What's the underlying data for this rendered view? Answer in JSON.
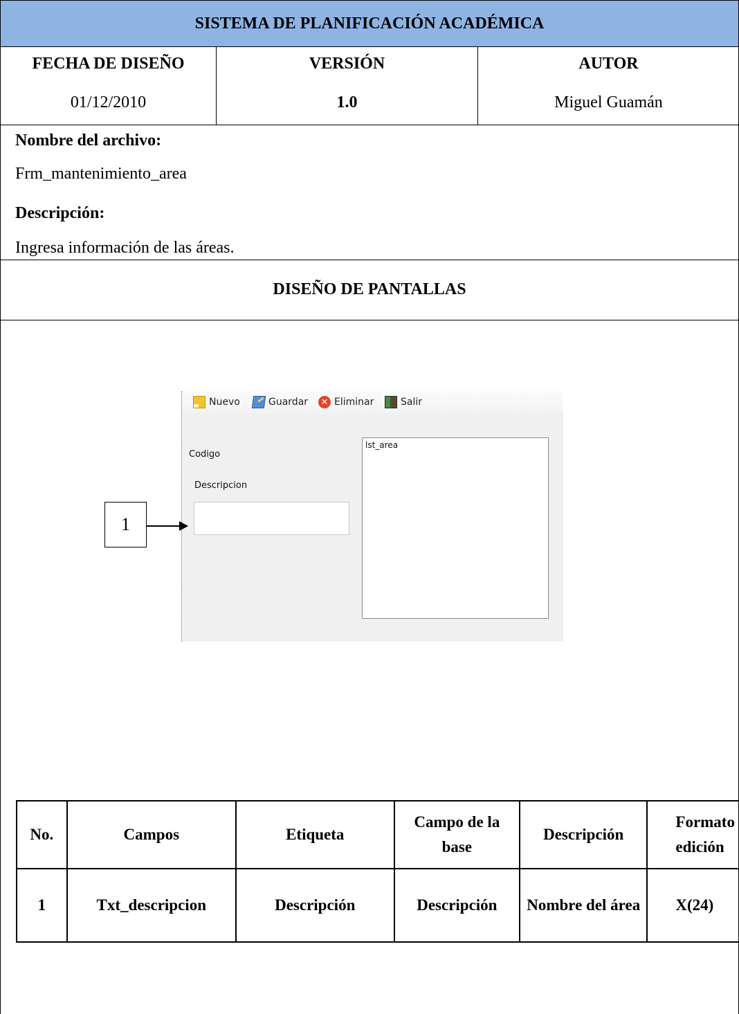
{
  "header": {
    "title": "SISTEMA DE PLANIFICACIÓN ACADÉMICA"
  },
  "meta": {
    "fecha_label": "FECHA DE DISEÑO",
    "fecha_value": "01/12/2010",
    "version_label": "VERSIÓN",
    "version_value": "1.0",
    "autor_label": "AUTOR",
    "autor_value": "Miguel Guamán"
  },
  "info": {
    "archivo_label": "Nombre del archivo:",
    "archivo_value": "Frm_mantenimiento_area",
    "descripcion_label": "Descripción:",
    "descripcion_value": "Ingresa información de las áreas."
  },
  "section": {
    "title": "DISEÑO DE PANTALLAS"
  },
  "screenshot": {
    "toolbar": [
      {
        "label": "Nuevo",
        "icon": "new-icon"
      },
      {
        "label": "Guardar",
        "icon": "save-icon"
      },
      {
        "label": "Eliminar",
        "icon": "delete-icon"
      },
      {
        "label": "Salir",
        "icon": "exit-icon"
      }
    ],
    "codigo_label": "Codigo",
    "descripcion_label": "Descripcion",
    "list_label": "lst_area",
    "callout_number": "1"
  },
  "fields_table": {
    "headers": [
      "No.",
      "Campos",
      "Etiqueta",
      "Campo de la base",
      "Descripción",
      "Formato edición"
    ],
    "rows": [
      {
        "no": "1",
        "campo": "Txt_descripcion",
        "etiqueta": "Descripción",
        "campo_base": "Descripción",
        "descripcion": "Nombre del área",
        "formato": "X(24)"
      }
    ]
  },
  "colors": {
    "header_bg": "#8eb4e3",
    "form_bg": "#f0f0f0"
  }
}
